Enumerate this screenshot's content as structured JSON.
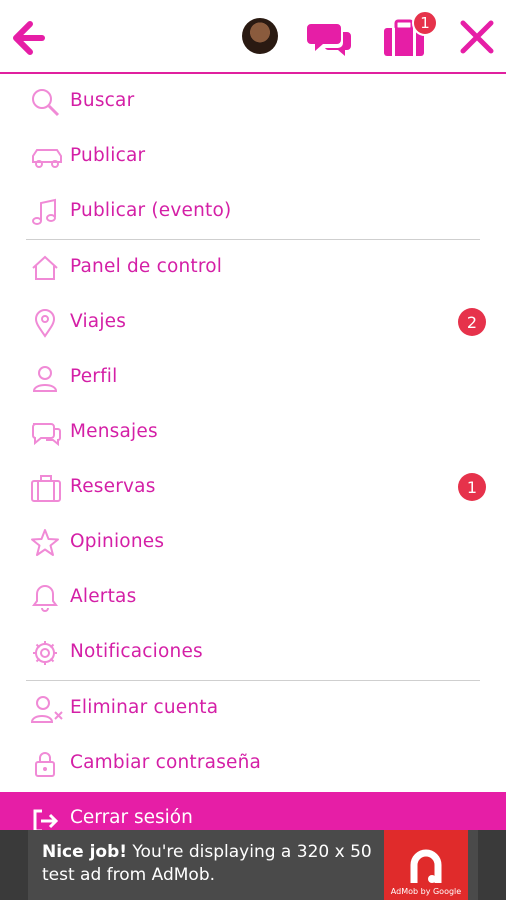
{
  "colors": {
    "accent": "#e61ea6",
    "text": "#d41fa6",
    "badge": "#e6324b"
  },
  "header": {
    "icons": [
      "back-arrow-icon",
      "avatar",
      "chat-icon",
      "suitcase-icon",
      "close-icon"
    ],
    "bag_badge": "1"
  },
  "menu": {
    "items": [
      {
        "label": "Buscar",
        "icon": "search-icon"
      },
      {
        "label": "Publicar",
        "icon": "car-icon"
      },
      {
        "label": "Publicar (evento)",
        "icon": "music-icon"
      },
      {
        "label": "Panel de control",
        "icon": "home-icon"
      },
      {
        "label": "Viajes",
        "icon": "location-pin-icon",
        "badge": "2"
      },
      {
        "label": "Perfil",
        "icon": "user-icon"
      },
      {
        "label": "Mensajes",
        "icon": "chat-bubbles-icon"
      },
      {
        "label": "Reservas",
        "icon": "suitcase-icon",
        "badge": "1"
      },
      {
        "label": "Opiniones",
        "icon": "star-icon"
      },
      {
        "label": "Alertas",
        "icon": "bell-icon"
      },
      {
        "label": "Notificaciones",
        "icon": "gear-icon"
      },
      {
        "label": "Eliminar cuenta",
        "icon": "remove-user-icon"
      },
      {
        "label": "Cambiar contraseña",
        "icon": "lock-icon"
      }
    ],
    "logout_label": "Cerrar sesión"
  },
  "ad": {
    "bold": "Nice job!",
    "text": " You're displaying a 320 x 50 test ad from AdMob.",
    "brand": "AdMob by Google"
  }
}
